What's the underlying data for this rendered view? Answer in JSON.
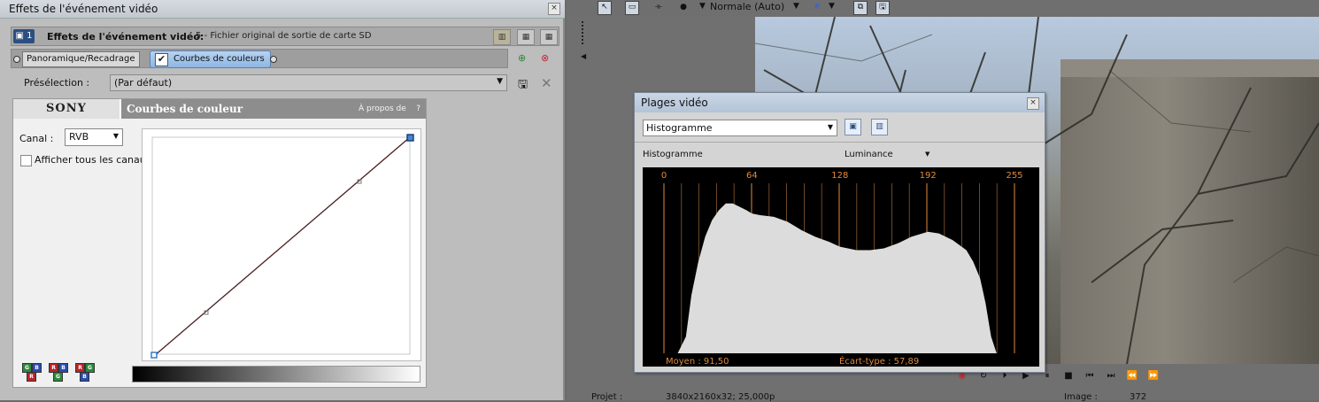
{
  "left_panel": {
    "window_title": "Effets de l'événement vidéo",
    "close_glyph": "×",
    "header": {
      "badge": "1",
      "title_label": "Effets de l'événement vidéo:",
      "title_value": "5 - Fichier original de sortie de carte SD"
    },
    "chain": {
      "items": [
        {
          "label": "Panoramique/Recadrage",
          "active": false
        },
        {
          "label": "Courbes de couleurs",
          "active": true,
          "checked": true
        }
      ]
    },
    "preset": {
      "label": "Présélection :",
      "value": "(Par défaut)"
    },
    "plugin": {
      "brand": "SONY",
      "title": "Courbes de couleur",
      "about": "À propos de",
      "help": "?",
      "canal_label": "Canal :",
      "canal_value": "RVB",
      "show_all_label": "Afficher tous les canaux",
      "rgb_presets": [
        {
          "top_left": "G",
          "top_right": "B",
          "bottom": "R"
        },
        {
          "top_left": "R",
          "top_right": "B",
          "bottom": "G"
        },
        {
          "top_left": "R",
          "top_right": "G",
          "bottom": "B"
        }
      ]
    }
  },
  "viewer": {
    "quality": "Normale (Auto)",
    "transport_buttons": [
      "record",
      "loop",
      "play-from-start",
      "play",
      "pause",
      "stop",
      "prev-frame",
      "next-frame",
      "prev-marker",
      "next-marker"
    ],
    "status": {
      "project_label": "Projet :",
      "project_value": "3840x2160x32; 25,000p",
      "image_label": "Image :",
      "image_value": "372"
    }
  },
  "scopes": {
    "title": "Plages vidéo",
    "close_glyph": "×",
    "mode": "Histogramme",
    "label_left": "Histogramme",
    "channel": "Luminance",
    "tick_labels": [
      {
        "value": 0,
        "label": "0"
      },
      {
        "value": 64,
        "label": "64"
      },
      {
        "value": 128,
        "label": "128"
      },
      {
        "value": 192,
        "label": "192"
      },
      {
        "value": 255,
        "label": "255"
      }
    ],
    "mean_label": "Moyen : 91,50",
    "stddev_label": "Écart-type : 57,89"
  },
  "chart_data": {
    "type": "area",
    "title": "Histogramme",
    "series_name": "Luminance",
    "x": [
      0,
      10,
      16,
      20,
      25,
      30,
      35,
      40,
      45,
      50,
      55,
      60,
      64,
      70,
      80,
      90,
      100,
      110,
      120,
      128,
      140,
      150,
      160,
      170,
      180,
      192,
      200,
      210,
      220,
      225,
      230,
      234,
      238,
      242,
      246,
      255
    ],
    "y": [
      0,
      0,
      0.1,
      0.35,
      0.55,
      0.7,
      0.8,
      0.86,
      0.9,
      0.9,
      0.88,
      0.86,
      0.84,
      0.83,
      0.82,
      0.79,
      0.74,
      0.7,
      0.67,
      0.64,
      0.62,
      0.62,
      0.63,
      0.66,
      0.7,
      0.73,
      0.72,
      0.68,
      0.62,
      0.55,
      0.45,
      0.3,
      0.1,
      0,
      0,
      0
    ],
    "xlim": [
      0,
      255
    ],
    "ylim": [
      0,
      1
    ],
    "grid": true,
    "stats": {
      "mean": 91.5,
      "stddev": 57.89
    }
  }
}
